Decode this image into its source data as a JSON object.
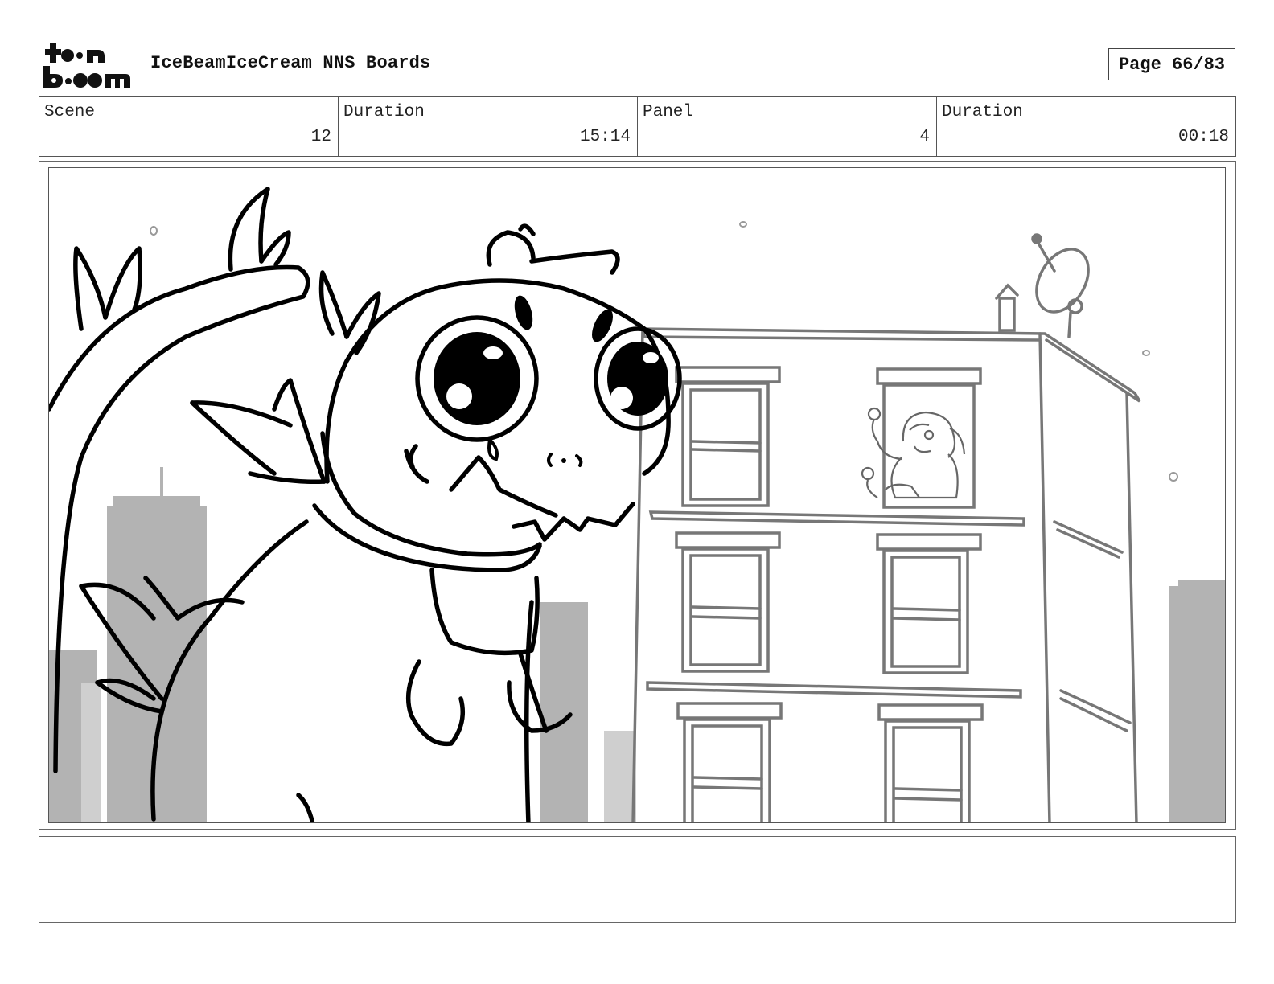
{
  "header": {
    "logo_text": "toon boom",
    "project_title": "IceBeamIceCream NNS Boards",
    "page_indicator": "Page 66/83"
  },
  "info": [
    {
      "label": "Scene",
      "value": "12"
    },
    {
      "label": "Duration",
      "value": "15:14"
    },
    {
      "label": "Panel",
      "value": "4"
    },
    {
      "label": "Duration",
      "value": "00:18"
    }
  ],
  "panel": {
    "illustration": "storyboard-sketch-dragon-and-apartment-building"
  },
  "notes": {
    "text": ""
  },
  "colors": {
    "ink": "#000000",
    "building_line": "#777777",
    "skyline_fill": "#b3b3b3"
  }
}
